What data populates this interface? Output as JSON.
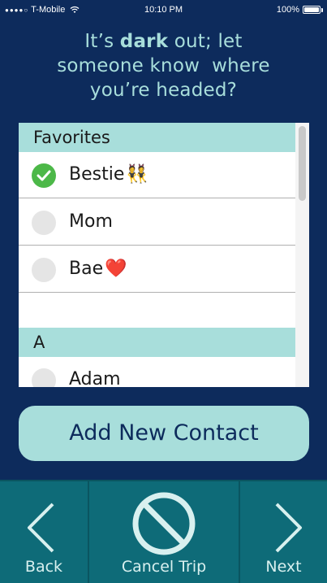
{
  "status_bar": {
    "signal": "●●●●○",
    "carrier": "T-Mobile",
    "time": "10:10 PM",
    "battery": "100%"
  },
  "prompt": {
    "line1_pre": "It’s ",
    "line1_bold": "dark",
    "line1_post": " out; let",
    "line2": "someone know  where",
    "line3": "you’re headed?"
  },
  "contacts": {
    "sections": [
      {
        "header": "Favorites",
        "items": [
          {
            "name": "Bestie",
            "emoji": "👯",
            "selected": true
          },
          {
            "name": "Mom",
            "emoji": "",
            "selected": false
          },
          {
            "name": "Bae",
            "emoji": "❤️",
            "selected": false
          }
        ]
      },
      {
        "header": "A",
        "items": [
          {
            "name": "Adam",
            "emoji": "",
            "selected": false
          }
        ]
      }
    ]
  },
  "add_contact": {
    "label": "Add New Contact"
  },
  "bottom_nav": {
    "back_label": "Back",
    "cancel_label": "Cancel Trip",
    "next_label": "Next"
  },
  "colors": {
    "background": "#0d2b5c",
    "accent_mint": "#a8dedb",
    "bottom_bar": "#0e6b78",
    "check_green": "#4cb848"
  }
}
